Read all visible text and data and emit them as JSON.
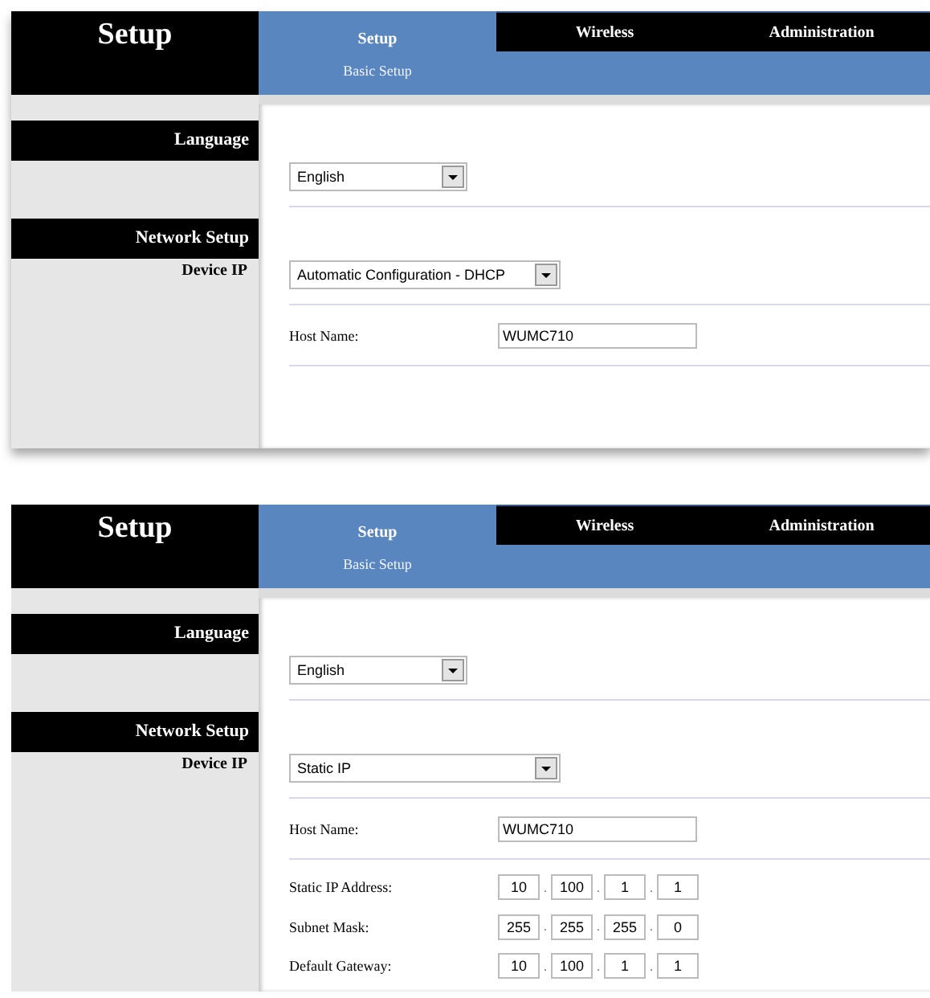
{
  "panels": [
    {
      "title": "Setup",
      "tabs": [
        {
          "label": "Setup",
          "selected": true,
          "subtab": "Basic Setup"
        },
        {
          "label": "Wireless",
          "selected": false
        },
        {
          "label": "Administration",
          "selected": false
        }
      ],
      "sidebar": [
        {
          "kind": "section",
          "label": "Language"
        },
        {
          "kind": "section",
          "label": "Network Setup"
        },
        {
          "kind": "item",
          "label": "Device IP"
        }
      ],
      "language_select": {
        "value": "English"
      },
      "device_ip_select": {
        "value": "Automatic Configuration - DHCP"
      },
      "host_name": {
        "label": "Host Name:",
        "value": "WUMC710"
      }
    },
    {
      "title": "Setup",
      "tabs": [
        {
          "label": "Setup",
          "selected": true,
          "subtab": "Basic Setup"
        },
        {
          "label": "Wireless",
          "selected": false
        },
        {
          "label": "Administration",
          "selected": false
        }
      ],
      "sidebar": [
        {
          "kind": "section",
          "label": "Language"
        },
        {
          "kind": "section",
          "label": "Network Setup"
        },
        {
          "kind": "item",
          "label": "Device IP"
        }
      ],
      "language_select": {
        "value": "English"
      },
      "device_ip_select": {
        "value": "Static IP"
      },
      "host_name": {
        "label": "Host Name:",
        "value": "WUMC710"
      },
      "ip_fields": [
        {
          "label": "Static IP Address:",
          "octets": [
            "10",
            "100",
            "1",
            "1"
          ],
          "separators": [
            ".",
            ".",
            "."
          ]
        },
        {
          "label": "Subnet Mask:",
          "octets": [
            "255",
            "255",
            "255",
            "0"
          ],
          "separators": [
            ".",
            ".",
            "."
          ]
        },
        {
          "label": "Default Gateway:",
          "octets": [
            "10",
            "100",
            "1",
            "1"
          ],
          "separators": [
            ".",
            ".",
            "."
          ]
        }
      ]
    }
  ]
}
